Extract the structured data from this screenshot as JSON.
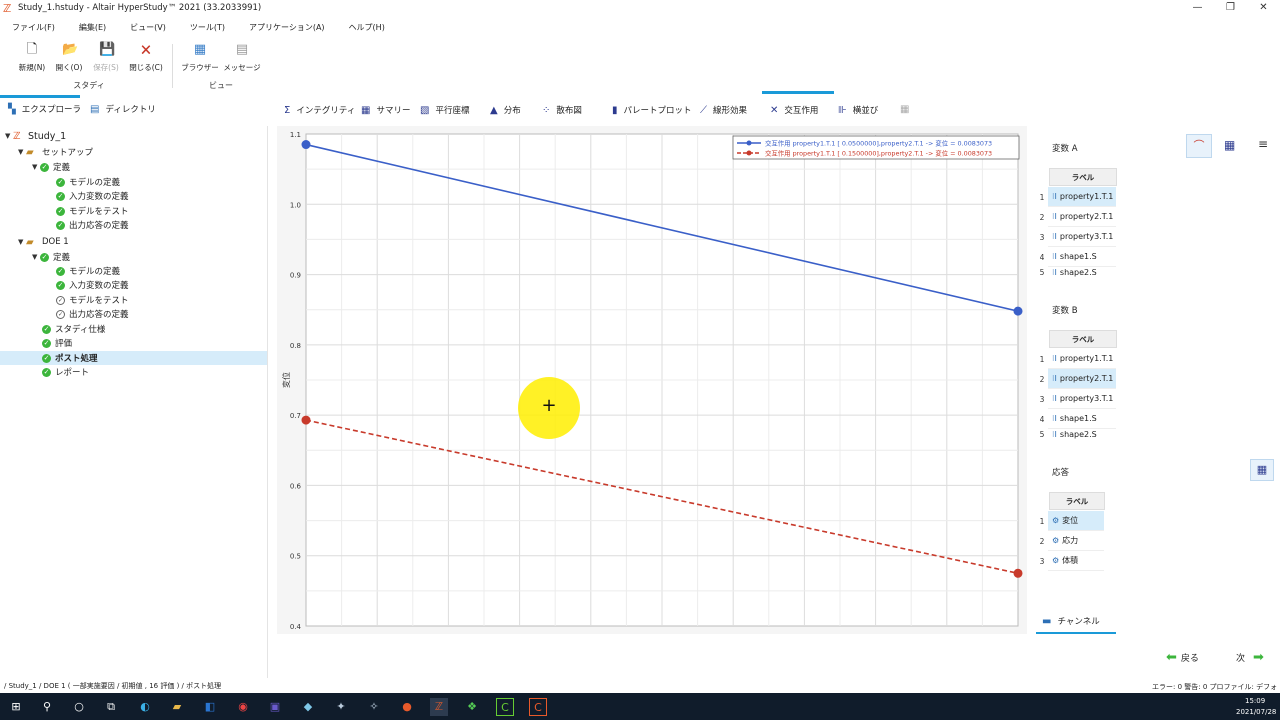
{
  "window": {
    "title": "Study_1.hstudy - Altair HyperStudy™ 2021 (33.2033991)",
    "controls": [
      "—",
      "❐",
      "✕"
    ]
  },
  "menu": [
    "ファイル(F)",
    "編集(E)",
    "ビュー(V)",
    "ツール(T)",
    "アプリケーション(A)",
    "ヘルプ(H)"
  ],
  "ribbon": {
    "new": "新規(N)",
    "open": "開く(O)",
    "save": "保存(S)",
    "close": "閉じる(C)",
    "browser": "ブラウザー",
    "message": "メッセージ",
    "group_study": "スタディ",
    "group_view": "ビュー"
  },
  "explorer_tabs": {
    "explorer": "エクスプローラ",
    "directory": "ディレクトリ"
  },
  "tree": {
    "study": "Study_1",
    "setup": "セットアップ",
    "define1": "定義",
    "model_def1": "モデルの定義",
    "input_def1": "入力変数の定義",
    "model_test1": "モデルをテスト",
    "output_def1": "出力応答の定義",
    "doe": "DOE 1",
    "define2": "定義",
    "model_def2": "モデルの定義",
    "input_def2": "入力変数の定義",
    "model_test2": "モデルをテスト",
    "output_def2": "出力応答の定義",
    "spec": "スタディ仕様",
    "eval": "評価",
    "post": "ポスト処理",
    "report": "レポート"
  },
  "tool_tabs": [
    "インテグリティ",
    "サマリー",
    "平行座標",
    "分布",
    "散布図",
    "パレートプロット",
    "線形効果",
    "交互作用",
    "横並び"
  ],
  "chart_data": {
    "type": "line",
    "ylabel": "変位",
    "ylim": [
      0.4,
      1.1
    ],
    "yticks": [
      "1.1",
      "1.0",
      "0.9",
      "0.8",
      "0.7",
      "0.6",
      "0.5",
      "0.4"
    ],
    "x": [
      0,
      1
    ],
    "series": [
      {
        "name": "交互作用 property1.T.1 [ 0.0500000],property2.T.1 -> 変位 = 0.0083073",
        "values": [
          1.085,
          0.848
        ],
        "color": "#3a5fc8",
        "dash": false
      },
      {
        "name": "交互作用 property1.T.1 [ 0.1500000],property2.T.1 -> 変位 = 0.0083073",
        "values": [
          0.693,
          0.475
        ],
        "color": "#c83a2b",
        "dash": true
      }
    ]
  },
  "var_a": {
    "title": "変数 A",
    "header": "ラベル",
    "rows": [
      {
        "n": "1",
        "label": "property1.T.1"
      },
      {
        "n": "2",
        "label": "property2.T.1"
      },
      {
        "n": "3",
        "label": "property3.T.1"
      },
      {
        "n": "4",
        "label": "shape1.S"
      },
      {
        "n": "5",
        "label": "shape2.S"
      }
    ]
  },
  "var_b": {
    "title": "変数 B",
    "header": "ラベル",
    "rows": [
      {
        "n": "1",
        "label": "property1.T.1"
      },
      {
        "n": "2",
        "label": "property2.T.1"
      },
      {
        "n": "3",
        "label": "property3.T.1"
      },
      {
        "n": "4",
        "label": "shape1.S"
      },
      {
        "n": "5",
        "label": "shape2.S"
      }
    ]
  },
  "response": {
    "title": "応答",
    "header": "ラベル",
    "rows": [
      {
        "n": "1",
        "label": "変位"
      },
      {
        "n": "2",
        "label": "応力"
      },
      {
        "n": "3",
        "label": "体積"
      }
    ]
  },
  "channel": "チャンネル",
  "nav": {
    "back": "戻る",
    "next": "次"
  },
  "status": {
    "path": "/ Study_1 / DOE 1 ( 一部実施要因 / 初期値 , 16 評価 ) / ポスト処理",
    "right": "エラー: 0  警告: 0    プロファイル: デフォルト"
  },
  "clock": {
    "time": "15:09",
    "date": "2021/07/28"
  }
}
